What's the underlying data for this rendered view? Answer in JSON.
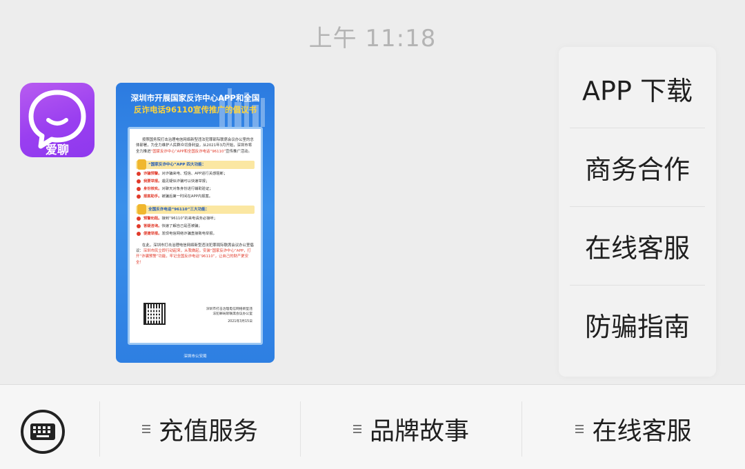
{
  "chat": {
    "timestamp": "上午 11:18",
    "avatar_label": "爱聊",
    "poster": {
      "title_line1": "深圳市开展国家反诈中心APP和全国",
      "title_line2": "反诈电话96110宣传推广的倡议书",
      "intro": "按照国务院打击治理电信网络新型违法犯罪部际联席会议办公室的总体部署，为全力维护人民群众切身利益，从2021年3月开始，深圳市将全力推进",
      "intro_red": "“国家反诈中心”APP和全国反诈电话“96110”",
      "intro_end": "宣传推广活动。",
      "section1": "“国家反诈中心”APP 四大功能：",
      "s1_items": [
        {
          "key": "诈骗预警。",
          "text": "对诈骗来电、短信、APP进行关感阻断；"
        },
        {
          "key": "我要举报。",
          "text": "遇见疑似诈骗可以快速举报；"
        },
        {
          "key": "身份核实。",
          "text": "对聊天对象身份进行辅助验证；"
        },
        {
          "key": "报案助手。",
          "text": "被骗后第一时间在APP内报案。"
        }
      ],
      "section2": "全国反诈电话“96110”三大功能：",
      "s2_items": [
        {
          "key": "预警劝阻。",
          "text": "接到“96110”的来电请务必接听；"
        },
        {
          "key": "答疑咨询。",
          "text": "快速了解自己是否被骗；"
        },
        {
          "key": "便捷举报。",
          "text": "发现电信网络诈骗直接致电举报。"
        }
      ],
      "closing": "在此，深圳市打击治理电信网络新型违法犯罪局际联席会议办公室倡议：",
      "closing_red": "深圳市民立即行动起来，从我做起，安装“国家反诈中心”APP，打开“诈骗预警”功能，牢记全国反诈电话“96110”，让自己的财产更安全！",
      "signature": "深圳市打击治理电信网络新型违法犯罪局际联席会议办公室",
      "date": "2021年3月15日",
      "footer": "深圳市公安局"
    }
  },
  "menu": {
    "items": [
      "APP 下载",
      "商务合作",
      "在线客服",
      "防骗指南"
    ]
  },
  "bottom_bar": {
    "tabs": [
      "充值服务",
      "品牌故事",
      "在线客服"
    ]
  },
  "colors": {
    "avatar_purple": "#9a3ff0",
    "poster_blue": "#2c7be0",
    "accent_red": "#e13a2a",
    "accent_yellow": "#ffd43b"
  },
  "icons": {
    "keyboard": "keyboard-icon",
    "tab_menu": "menu-lines-icon",
    "avatar": "chat-bubble-smile-icon"
  }
}
